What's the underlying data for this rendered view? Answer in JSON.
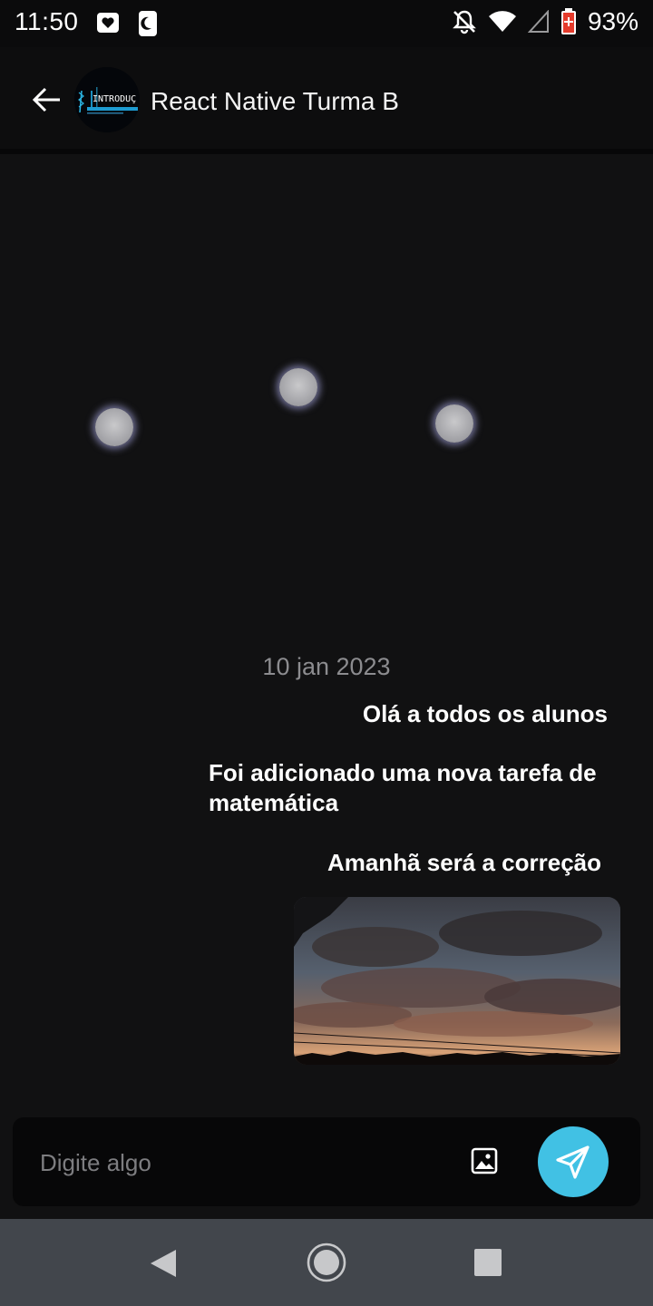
{
  "status_bar": {
    "time": "11:50",
    "battery_percent": "93%",
    "icons": [
      "heart-notification-icon",
      "moon-notification-icon",
      "bell-off-icon",
      "wifi-icon",
      "cell-signal-icon",
      "battery-icon"
    ]
  },
  "header": {
    "title": "React Native Turma B",
    "avatar_text": "INTRODUÇ"
  },
  "chat": {
    "date": "10 jan 2023",
    "messages": [
      {
        "text": "Olá a todos os alunos"
      },
      {
        "text": "Foi adicionado uma nova tarefa de matemática"
      },
      {
        "text": "Amanhã será a correção"
      }
    ],
    "image_message": {
      "icon": "photo-sunset-image"
    }
  },
  "composer": {
    "placeholder": "Digite algo",
    "accent_color": "#41c1e4"
  },
  "nav": {
    "icons": [
      "back-triangle-icon",
      "home-circle-icon",
      "recent-square-icon"
    ]
  }
}
